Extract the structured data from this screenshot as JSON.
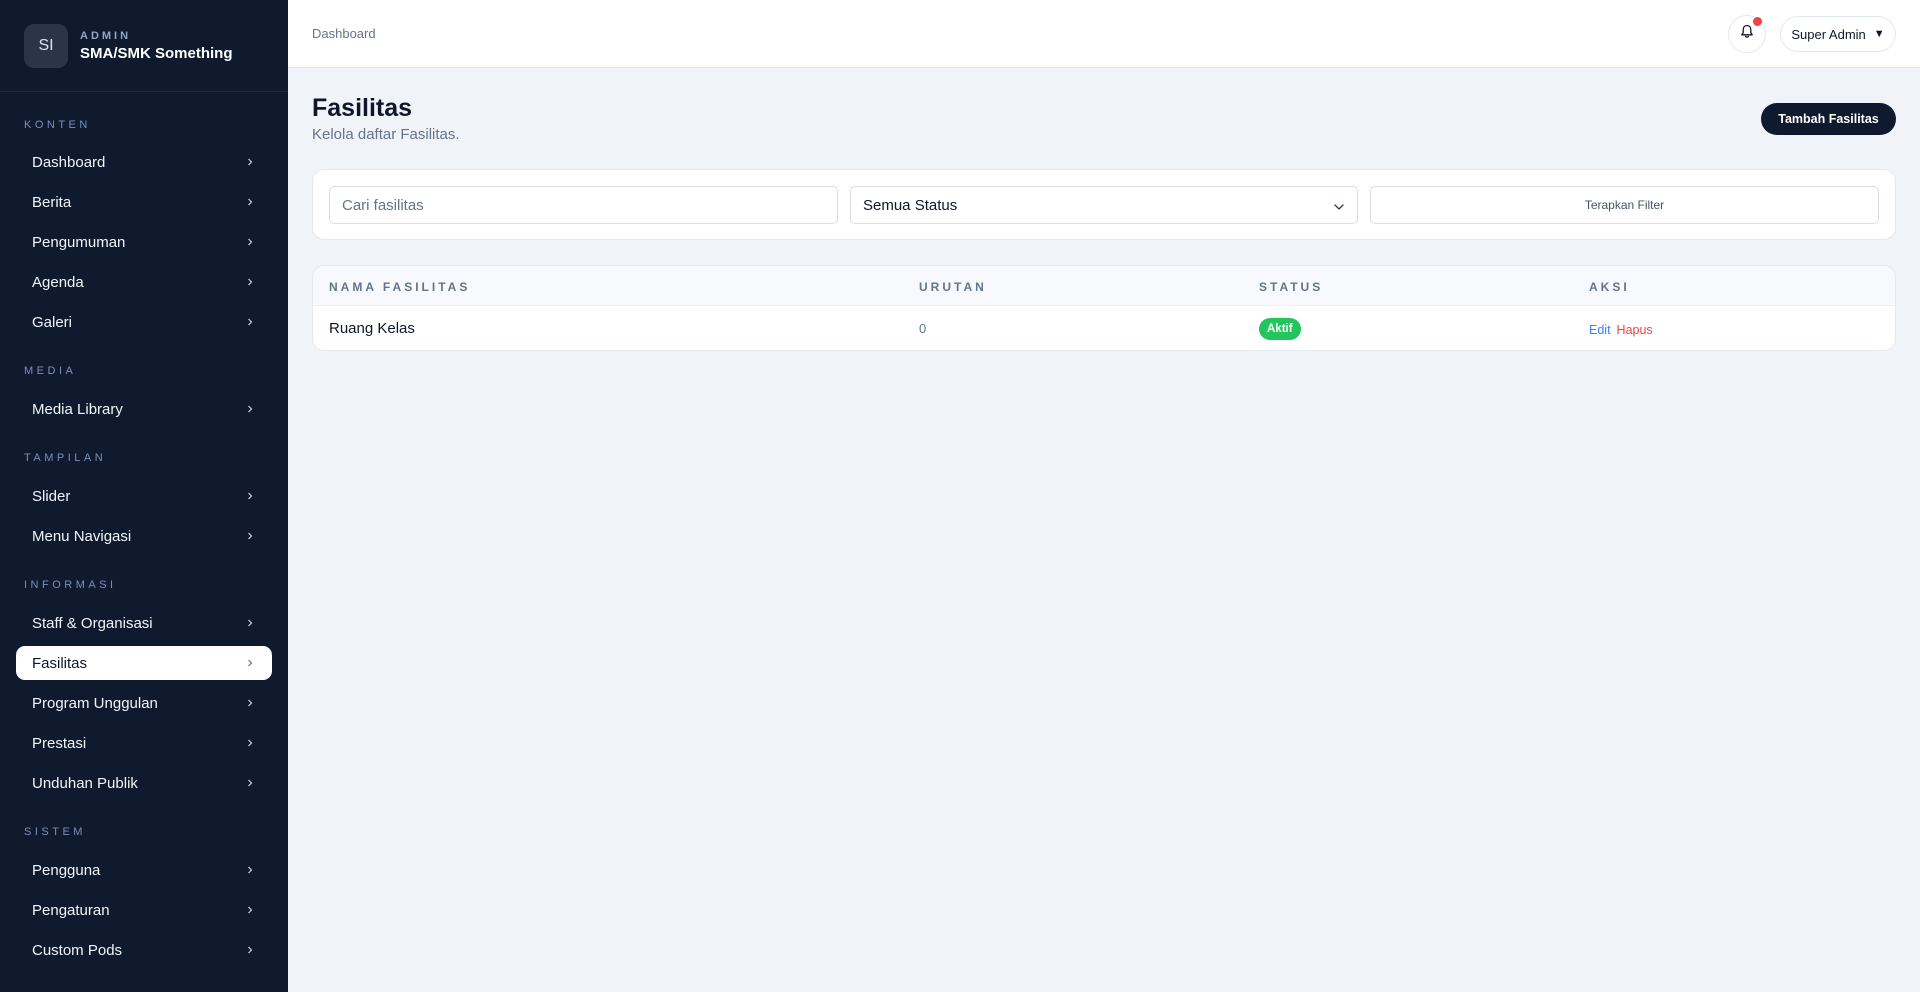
{
  "brand": {
    "logo": "SI",
    "role": "ADMIN",
    "name": "SMA/SMK Something"
  },
  "sidebar": {
    "sections": [
      {
        "label": "KONTEN",
        "items": [
          "Dashboard",
          "Berita",
          "Pengumuman",
          "Agenda",
          "Galeri"
        ]
      },
      {
        "label": "MEDIA",
        "items": [
          "Media Library"
        ]
      },
      {
        "label": "TAMPILAN",
        "items": [
          "Slider",
          "Menu Navigasi"
        ]
      },
      {
        "label": "INFORMASI",
        "items": [
          "Staff & Organisasi",
          "Fasilitas",
          "Program Unggulan",
          "Prestasi",
          "Unduhan Publik"
        ]
      },
      {
        "label": "SISTEM",
        "items": [
          "Pengguna",
          "Pengaturan",
          "Custom Pods"
        ]
      }
    ],
    "active_item": "Fasilitas"
  },
  "header": {
    "breadcrumb": "Dashboard",
    "user": "Super Admin",
    "user_caret": "▼"
  },
  "page": {
    "title": "Fasilitas",
    "subtitle": "Kelola daftar Fasilitas.",
    "add_button": "Tambah Fasilitas"
  },
  "filters": {
    "search_placeholder": "Cari fasilitas",
    "status_value": "Semua Status",
    "apply_button": "Terapkan Filter"
  },
  "table": {
    "headers": [
      "NAMA FASILITAS",
      "URUTAN",
      "STATUS",
      "AKSI"
    ],
    "rows": [
      {
        "name": "Ruang Kelas",
        "order": "0",
        "status": "Aktif",
        "edit": "Edit",
        "delete": "Hapus"
      }
    ]
  },
  "colors": {
    "sidebar_bg": "#0f1a2e",
    "accent_dark": "#0f1a2e",
    "status_active": "#22c55e",
    "link_edit": "#3b82f6",
    "link_delete": "#ef4444",
    "notification_dot": "#ef4444"
  },
  "icons": {
    "bell": "bell-icon",
    "chevron": "chevron-right-icon",
    "select": "chevron-down-icon"
  }
}
